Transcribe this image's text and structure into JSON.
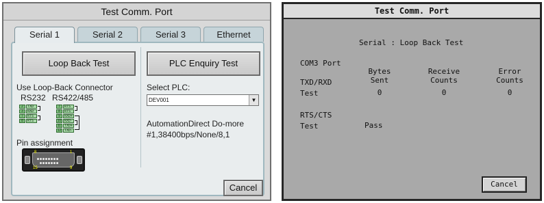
{
  "left": {
    "title": "Test Comm. Port",
    "tabs": [
      {
        "label": "Serial 1"
      },
      {
        "label": "Serial 2"
      },
      {
        "label": "Serial 3"
      },
      {
        "label": "Ethernet"
      }
    ],
    "loop_back_button": "Loop Back Test",
    "plc_enquiry_button": "PLC Enquiry Test",
    "use_connector_label": "Use Loop-Back Connector",
    "rs232_label": "RS232",
    "rs422_label": "RS422/485",
    "rs232_pins": [
      {
        "num": "2",
        "sig": "TXD"
      },
      {
        "num": "3",
        "sig": "RXD"
      },
      {
        "num": "7",
        "sig": "RTS"
      },
      {
        "num": "8",
        "sig": "RTS"
      }
    ],
    "rs422_pins": [
      {
        "num": "7",
        "sig": "RTS"
      },
      {
        "num": "8",
        "sig": "RTS"
      },
      {
        "num": "9",
        "sig": "RXD+"
      },
      {
        "num": "10",
        "sig": "RXD-"
      },
      {
        "num": "11",
        "sig": "TXD+"
      },
      {
        "num": "12",
        "sig": "TXD-"
      }
    ],
    "pin_assignment_label": "Pin assignment",
    "connector_pins": {
      "top_left": "8",
      "top_right": "1",
      "bottom_left": "15",
      "bottom_right": "9"
    },
    "select_plc_label": "Select PLC:",
    "select_plc_value": "DEV001",
    "plc_info": "AutomationDirect Do-more #1,38400bps/None/8,1",
    "cancel": "Cancel"
  },
  "right": {
    "title": "Test Comm. Port",
    "subtitle": "Serial : Loop Back Test",
    "port": "COM3 Port",
    "col_bytes": [
      "Bytes",
      "Sent"
    ],
    "col_receive": [
      "Receive",
      "Counts"
    ],
    "col_error": [
      "Error",
      "Counts"
    ],
    "txd_rxd": [
      "TXD/RXD",
      "Test"
    ],
    "bytes_sent": "0",
    "receive_counts": "0",
    "error_counts": "0",
    "rts_cts": [
      "RTS/CTS",
      "Test"
    ],
    "rts_result": "Pass",
    "cancel": "Cancel"
  }
}
